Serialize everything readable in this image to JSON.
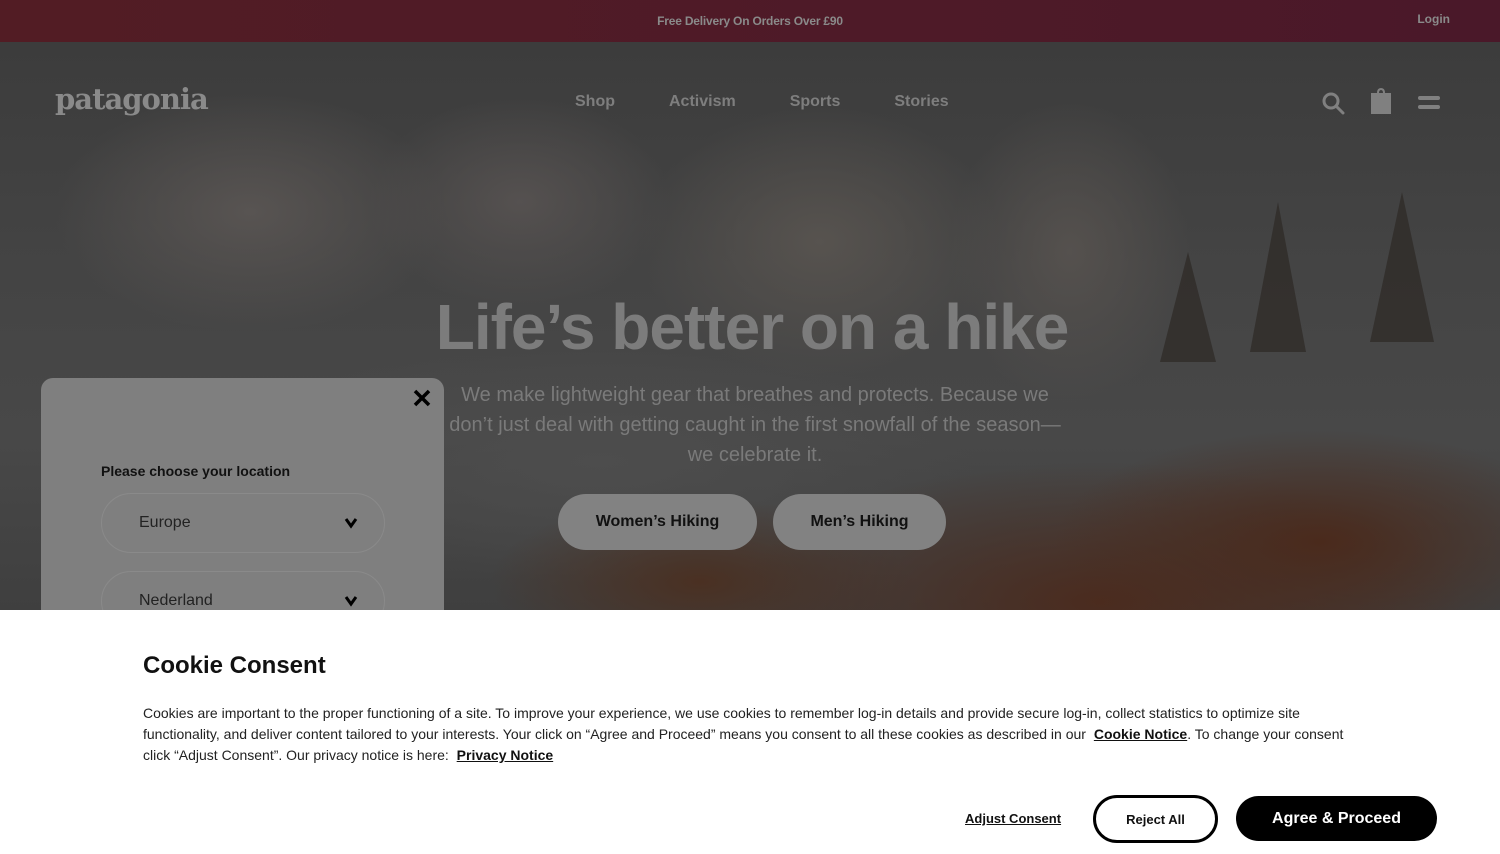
{
  "promo_bar": {
    "message": "Free Delivery On Orders Over £90",
    "login_label": "Login",
    "background_color": "#521c24"
  },
  "header": {
    "logo_text": "patagonia",
    "nav": [
      {
        "label": "Shop"
      },
      {
        "label": "Activism"
      },
      {
        "label": "Sports"
      },
      {
        "label": "Stories"
      }
    ],
    "icons": [
      "search-icon",
      "shopping-bag-icon",
      "menu-icon"
    ]
  },
  "hero": {
    "title": "Life’s better on a hike",
    "description": "We make lightweight gear that breathes and protects. Because we don’t just deal with getting caught in the first snowfall of the season—we celebrate it.",
    "buttons": [
      {
        "label": "Women’s Hiking"
      },
      {
        "label": "Men’s Hiking"
      }
    ]
  },
  "location_modal": {
    "label": "Please choose your location",
    "region": {
      "selected": "Europe"
    },
    "country": {
      "selected": "Nederland"
    },
    "close_icon": "close-icon"
  },
  "cookie_banner": {
    "title": "Cookie Consent",
    "text_part1": "Cookies are important to the proper functioning of a site. To improve your experience, we use cookies to remember log-in details and provide secure log-in, collect statistics to optimize site functionality, and deliver content tailored to your interests. Your click on “Agree and Proceed” means you consent to all these cookies as described in our ",
    "cookie_notice_link": "Cookie Notice",
    "text_part2": ". To change your consent click “Adjust Consent”. Our privacy notice is here: ",
    "privacy_notice_link": "Privacy Notice",
    "adjust_label": "Adjust Consent",
    "reject_label": "Reject All",
    "agree_label": "Agree & Proceed"
  }
}
